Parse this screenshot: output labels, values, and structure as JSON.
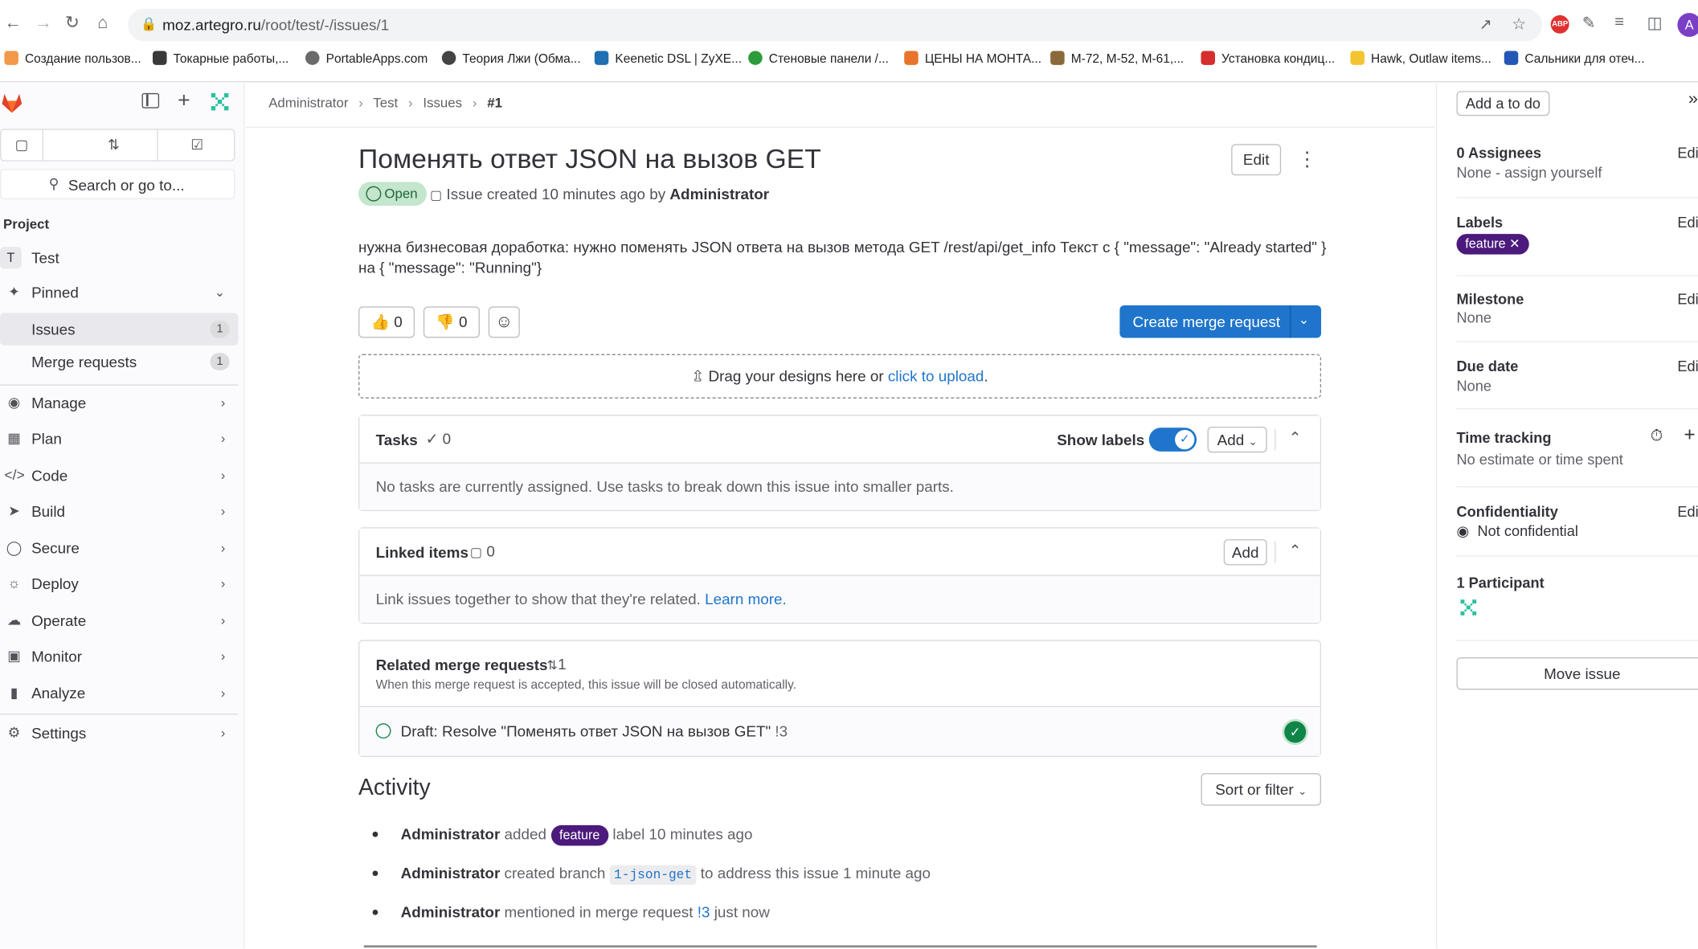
{
  "browser": {
    "url_host": "moz.artegro.ru",
    "url_path": "/root/test/-/issues/1",
    "abp_label": "ABP",
    "profile_initial": "A",
    "bookmarks": [
      "Создание пользов...",
      "Токарные работы,...",
      "PortableApps.com",
      "Теория Лжи (Обма...",
      "Keenetic DSL | ZyXE...",
      "Стеновые панели /...",
      "ЦЕНЫ НА МОНТА...",
      "М-72, М-52, М-61,...",
      "Установка кондиц...",
      "Hawk, Outlaw items...",
      "Сальники для отеч..."
    ]
  },
  "sidebar": {
    "search_placeholder": "Search or go to...",
    "section_title": "Project",
    "project_initial": "T",
    "project_name": "Test",
    "pinned_label": "Pinned",
    "issues_label": "Issues",
    "issues_count": "1",
    "mr_label": "Merge requests",
    "mr_count": "1",
    "nav": [
      "Manage",
      "Plan",
      "Code",
      "Build",
      "Secure",
      "Deploy",
      "Operate",
      "Monitor",
      "Analyze"
    ],
    "settings_label": "Settings"
  },
  "breadcrumb": {
    "items": [
      "Administrator",
      "Test",
      "Issues",
      "#1"
    ]
  },
  "issue": {
    "title": "Поменять ответ JSON на вызов GET",
    "edit_label": "Edit",
    "status": "Open",
    "meta_prefix": "Issue created 10 minutes ago by",
    "author": "Administrator",
    "description_line1": "нужна бизнесовая доработка: нужно поменять JSON ответа на вызов метода GET /rest/api/get_info Текст с { \"message\": \"Already started\" }",
    "description_line2": "на { \"message\": \"Running\"}",
    "thumbs_up": "0",
    "thumbs_down": "0",
    "create_mr_label": "Create merge request",
    "upload_text": "Drag your designs here or",
    "upload_link": "click to upload",
    "upload_end": "."
  },
  "tasks": {
    "title": "Tasks",
    "count": "0",
    "show_labels": "Show labels",
    "add_label": "Add",
    "empty_text": "No tasks are currently assigned. Use tasks to break down this issue into smaller parts."
  },
  "linked": {
    "title": "Linked items",
    "count": "0",
    "add_label": "Add",
    "text": "Link issues together to show that they're related.",
    "learn_more": "Learn more."
  },
  "related_mr": {
    "title": "Related merge requests",
    "count": "1",
    "subtitle": "When this merge request is accepted, this issue will be closed automatically.",
    "item_title": "Draft: Resolve \"Поменять ответ JSON на вызов GET\"",
    "item_ref": "!3"
  },
  "activity": {
    "title": "Activity",
    "sort_label": "Sort or filter",
    "items": [
      {
        "user": "Administrator",
        "pre": "added",
        "chip": "feature",
        "post": "label 10 minutes ago"
      },
      {
        "user": "Administrator",
        "pre": "created branch",
        "code": "1-json-get",
        "post": "to address this issue 1 minute ago"
      },
      {
        "user": "Administrator",
        "pre": "mentioned in merge request",
        "ref": "!3",
        "post": "just now"
      }
    ]
  },
  "right_sidebar": {
    "todo_label": "Add a to do",
    "edit_label": "Edi",
    "assignees_title": "0 Assignees",
    "assignees_value": "None - assign yourself",
    "labels_title": "Labels",
    "label_chip": "feature",
    "milestone_title": "Milestone",
    "milestone_value": "None",
    "due_title": "Due date",
    "due_value": "None",
    "time_title": "Time tracking",
    "time_value": "No estimate or time spent",
    "conf_title": "Confidentiality",
    "conf_value": "Not confidential",
    "participants_title": "1 Participant",
    "move_label": "Move issue"
  },
  "colors": {
    "accent": "#1f75cb",
    "open_badge_bg": "#c3e6cd",
    "label_purple": "#4b1a7c",
    "success": "#108548",
    "gitlab_orange": "#e24329"
  }
}
